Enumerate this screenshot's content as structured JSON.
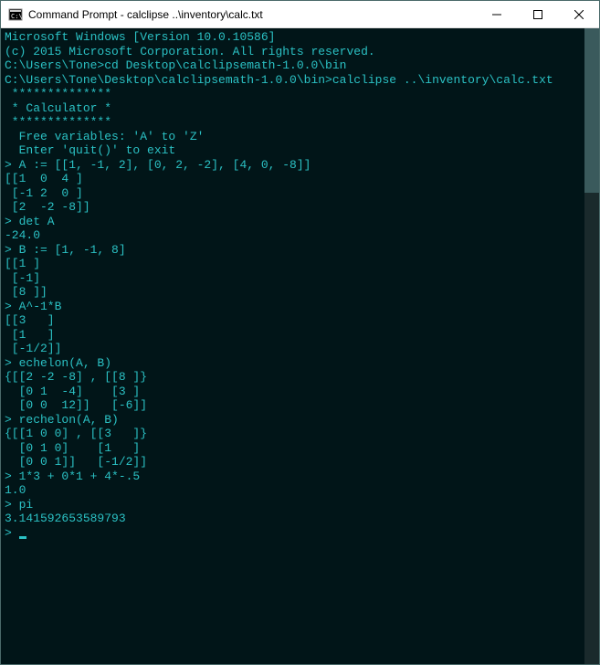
{
  "window": {
    "title": "Command Prompt - calclipse  ..\\inventory\\calc.txt"
  },
  "lines": [
    "Microsoft Windows [Version 10.0.10586]",
    "(c) 2015 Microsoft Corporation. All rights reserved.",
    "",
    "C:\\Users\\Tone>cd Desktop\\calclipsemath-1.0.0\\bin",
    "",
    "C:\\Users\\Tone\\Desktop\\calclipsemath-1.0.0\\bin>calclipse ..\\inventory\\calc.txt",
    "",
    " **************",
    " * Calculator *",
    " **************",
    "",
    "  Free variables: 'A' to 'Z'",
    "  Enter 'quit()' to exit",
    "",
    "",
    "> A := [[1, -1, 2], [0, 2, -2], [4, 0, -8]]",
    "[[1  0  4 ]",
    " [-1 2  0 ]",
    " [2  -2 -8]]",
    "> det A",
    "-24.0",
    "> B := [1, -1, 8]",
    "[[1 ]",
    " [-1]",
    " [8 ]]",
    "> A^-1*B",
    "[[3   ]",
    " [1   ]",
    " [-1/2]]",
    "> echelon(A, B)",
    "{[[2 -2 -8] , [[8 ]}",
    "  [0 1  -4]    [3 ]",
    "  [0 0  12]]   [-6]]",
    "> rechelon(A, B)",
    "{[[1 0 0] , [[3   ]}",
    "  [0 1 0]    [1   ]",
    "  [0 0 1]]   [-1/2]]",
    "> 1*3 + 0*1 + 4*-.5",
    "1.0",
    "> pi",
    "3.141592653589793",
    "> "
  ]
}
